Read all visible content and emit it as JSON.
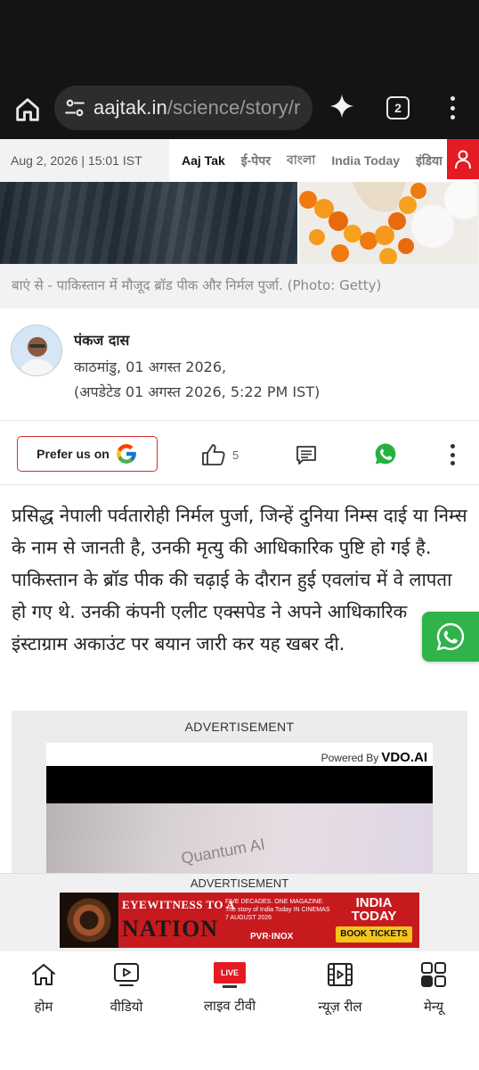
{
  "browser": {
    "url_host": "aajtak.in",
    "url_path": "/science/story/r",
    "tab_count": "2"
  },
  "header": {
    "date": "Aug 2, 2026 | 15:01 IST",
    "nav": [
      "Aaj Tak",
      "ई-पेपर",
      "বাংলা",
      "India Today",
      "इंडिया"
    ]
  },
  "caption": "बाएं से - पाकिस्तान में मौजूद ब्रॉड पीक और निर्मल पुर्जा. (Photo: Getty)",
  "author": {
    "name": "पंकज दास",
    "location_date": "काठमांडु, 01 अगस्त 2026,",
    "updated": "(अपडेटेड 01 अगस्त 2026, 5:22 PM IST)"
  },
  "actions": {
    "prefer_label": "Prefer us on",
    "like_count": "5"
  },
  "article": {
    "paragraph": "प्रसिद्ध नेपाली पर्वतारोही निर्मल पुर्जा, जिन्हें दुनिया निम्स दाई या निम्स के नाम से जानती है, उनकी मृत्यु की आधिकारिक पुष्टि हो गई है. पाकिस्तान के ब्रॉड पीक की चढ़ाई के दौरान हुई एवलांच में वे लापता हो गए थे. उनकी कंपनी एलीट एक्सपेड ने अपने आधिकारिक इंस्टाग्राम अकाउंट पर बयान जारी कर यह खबर दी."
  },
  "ad1": {
    "label": "ADVERTISEMENT",
    "powered_by": "Powered By",
    "brand": "VDO.AI",
    "video_text": "Quantum AI"
  },
  "sticky_ad": {
    "label": "ADVERTISEMENT",
    "title_top": "EYEWITNESS TO A",
    "title_main": "NATION",
    "tagline": "FIVE DECADES. ONE MAGAZINE. The story of India Today IN CINEMAS 7 AUGUST 2026",
    "partner": "PVR·INOX",
    "brand": "INDIA TODAY",
    "cta": "BOOK TICKETS"
  },
  "bottom_nav": {
    "home": "होम",
    "video": "वीडियो",
    "live_badge": "LIVE",
    "live_tv": "लाइव टीवी",
    "news_reel": "न्यूज़ रील",
    "menu": "मेन्यू"
  },
  "colors": {
    "brand_red": "#e41b23",
    "whatsapp_green": "#2fb34a",
    "browser_bg": "#141414"
  }
}
